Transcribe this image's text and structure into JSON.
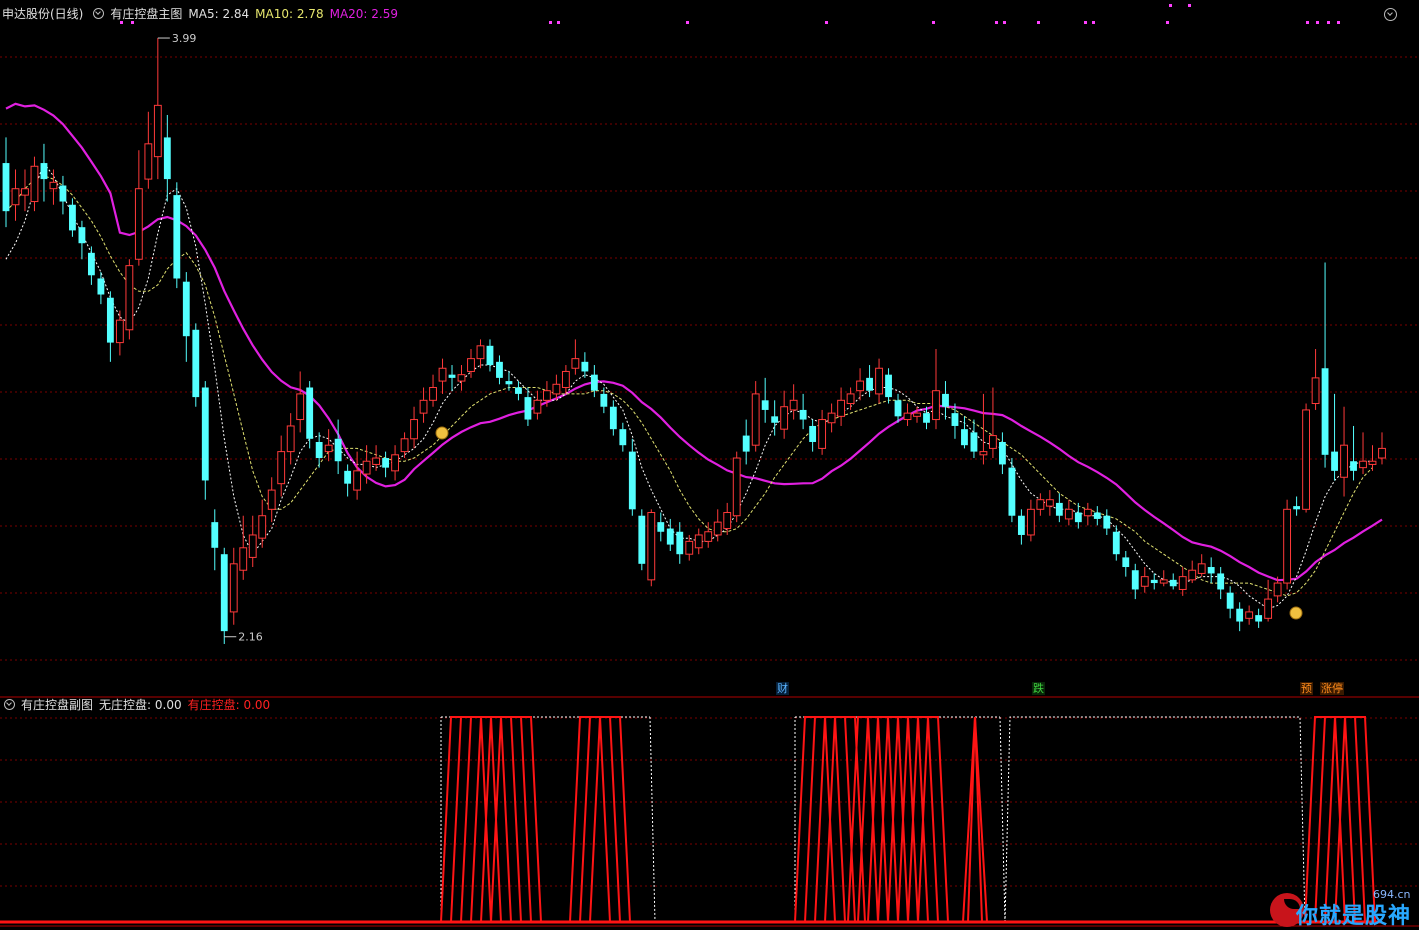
{
  "main_header": {
    "stock_name": "申达股份(日线)",
    "indicator_name": "有庄控盘主图",
    "ma5": "MA5: 2.84",
    "ma10": "MA10: 2.78",
    "ma20": "MA20: 2.59"
  },
  "sub_header": {
    "indicator_name": "有庄控盘副图",
    "no_control": "无庄控盘: 0.00",
    "with_control": "有庄控盘: 0.00"
  },
  "annotations": {
    "high_label": "3.99",
    "low_label": "2.16"
  },
  "events": [
    {
      "label": "财",
      "color": "#5ab4ff",
      "bg": "#06203a"
    },
    {
      "label": "跌",
      "color": "#3fd13f",
      "bg": "#082808"
    },
    {
      "label": "预",
      "color": "#ff8c1a",
      "bg": "#3a1a00"
    },
    {
      "label": "涨停",
      "color": "#ff8c1a",
      "bg": "#3a1a00"
    }
  ],
  "colors": {
    "up": "#ff3a3a",
    "down": "#54ffff",
    "ma20": "#e020e0",
    "ma_dash": "#e0e070",
    "grid": "#7a0000",
    "sub_red": "#ff1414",
    "sub_white": "#ffffff",
    "marker": "#ff40ff"
  },
  "watermark": {
    "text": "你就是股神",
    "site": "694.cn"
  },
  "chart_data": {
    "type": "candlestick",
    "ylim": [
      2.05,
      4.04
    ],
    "high": 3.99,
    "low": 2.16,
    "candles": [
      [
        3.6,
        3.45,
        3.68,
        3.4
      ],
      [
        3.47,
        3.52,
        3.58,
        3.42
      ],
      [
        3.5,
        3.52,
        3.58,
        3.45
      ],
      [
        3.48,
        3.59,
        3.62,
        3.45
      ],
      [
        3.6,
        3.55,
        3.66,
        3.48
      ],
      [
        3.52,
        3.54,
        3.58,
        3.47
      ],
      [
        3.53,
        3.48,
        3.56,
        3.44
      ],
      [
        3.47,
        3.39,
        3.49,
        3.37
      ],
      [
        3.4,
        3.35,
        3.42,
        3.3
      ],
      [
        3.32,
        3.25,
        3.34,
        3.22
      ],
      [
        3.24,
        3.19,
        3.26,
        3.16
      ],
      [
        3.18,
        3.04,
        3.2,
        2.98
      ],
      [
        3.04,
        3.11,
        3.14,
        3.0
      ],
      [
        3.08,
        3.28,
        3.3,
        3.05
      ],
      [
        3.3,
        3.52,
        3.64,
        3.28
      ],
      [
        3.55,
        3.66,
        3.76,
        3.52
      ],
      [
        3.62,
        3.78,
        3.99,
        3.55
      ],
      [
        3.68,
        3.55,
        3.75,
        3.48
      ],
      [
        3.5,
        3.24,
        3.54,
        3.21
      ],
      [
        3.23,
        3.06,
        3.26,
        2.98
      ],
      [
        3.08,
        2.87,
        3.1,
        2.84
      ],
      [
        2.9,
        2.61,
        2.92,
        2.55
      ],
      [
        2.48,
        2.4,
        2.52,
        2.33
      ],
      [
        2.38,
        2.14,
        2.4,
        2.1
      ],
      [
        2.2,
        2.35,
        2.4,
        2.16
      ],
      [
        2.33,
        2.4,
        2.5,
        2.3
      ],
      [
        2.37,
        2.44,
        2.5,
        2.34
      ],
      [
        2.43,
        2.5,
        2.55,
        2.4
      ],
      [
        2.52,
        2.58,
        2.62,
        2.48
      ],
      [
        2.6,
        2.7,
        2.75,
        2.56
      ],
      [
        2.7,
        2.78,
        2.82,
        2.66
      ],
      [
        2.8,
        2.88,
        2.95,
        2.76
      ],
      [
        2.9,
        2.74,
        2.92,
        2.71
      ],
      [
        2.73,
        2.68,
        2.76,
        2.65
      ],
      [
        2.7,
        2.72,
        2.77,
        2.67
      ],
      [
        2.74,
        2.67,
        2.8,
        2.63
      ],
      [
        2.64,
        2.6,
        2.66,
        2.56
      ],
      [
        2.58,
        2.64,
        2.7,
        2.55
      ],
      [
        2.63,
        2.67,
        2.72,
        2.6
      ],
      [
        2.66,
        2.68,
        2.72,
        2.64
      ],
      [
        2.68,
        2.65,
        2.7,
        2.62
      ],
      [
        2.64,
        2.69,
        2.72,
        2.61
      ],
      [
        2.7,
        2.74,
        2.76,
        2.68
      ],
      [
        2.74,
        2.8,
        2.84,
        2.71
      ],
      [
        2.82,
        2.86,
        2.9,
        2.79
      ],
      [
        2.86,
        2.9,
        2.94,
        2.84
      ],
      [
        2.92,
        2.96,
        2.99,
        2.88
      ],
      [
        2.94,
        2.93,
        2.97,
        2.89
      ],
      [
        2.92,
        2.94,
        2.97,
        2.89
      ],
      [
        2.95,
        2.99,
        3.02,
        2.93
      ],
      [
        2.99,
        3.03,
        3.05,
        2.96
      ],
      [
        3.03,
        2.97,
        3.05,
        2.95
      ],
      [
        2.98,
        2.93,
        3.0,
        2.91
      ],
      [
        2.92,
        2.91,
        2.95,
        2.89
      ],
      [
        2.9,
        2.88,
        2.92,
        2.86
      ],
      [
        2.87,
        2.8,
        2.9,
        2.78
      ],
      [
        2.82,
        2.86,
        2.89,
        2.8
      ],
      [
        2.86,
        2.89,
        2.92,
        2.84
      ],
      [
        2.88,
        2.91,
        2.94,
        2.86
      ],
      [
        2.9,
        2.95,
        2.97,
        2.88
      ],
      [
        2.96,
        2.99,
        3.05,
        2.94
      ],
      [
        2.98,
        2.95,
        3.01,
        2.93
      ],
      [
        2.94,
        2.89,
        2.97,
        2.87
      ],
      [
        2.88,
        2.84,
        2.9,
        2.82
      ],
      [
        2.84,
        2.77,
        2.86,
        2.75
      ],
      [
        2.77,
        2.72,
        2.79,
        2.7
      ],
      [
        2.7,
        2.52,
        2.74,
        2.5
      ],
      [
        2.5,
        2.35,
        2.52,
        2.33
      ],
      [
        2.3,
        2.51,
        2.52,
        2.28
      ],
      [
        2.48,
        2.45,
        2.51,
        2.42
      ],
      [
        2.46,
        2.41,
        2.49,
        2.39
      ],
      [
        2.45,
        2.38,
        2.48,
        2.35
      ],
      [
        2.38,
        2.42,
        2.44,
        2.36
      ],
      [
        2.4,
        2.44,
        2.46,
        2.38
      ],
      [
        2.42,
        2.45,
        2.48,
        2.4
      ],
      [
        2.44,
        2.48,
        2.52,
        2.42
      ],
      [
        2.46,
        2.51,
        2.54,
        2.44
      ],
      [
        2.5,
        2.68,
        2.7,
        2.48
      ],
      [
        2.75,
        2.7,
        2.8,
        2.66
      ],
      [
        2.72,
        2.88,
        2.92,
        2.7
      ],
      [
        2.86,
        2.83,
        2.93,
        2.79
      ],
      [
        2.81,
        2.79,
        2.86,
        2.75
      ],
      [
        2.77,
        2.84,
        2.89,
        2.74
      ],
      [
        2.83,
        2.86,
        2.91,
        2.8
      ],
      [
        2.83,
        2.8,
        2.88,
        2.77
      ],
      [
        2.78,
        2.73,
        2.8,
        2.7
      ],
      [
        2.71,
        2.8,
        2.83,
        2.69
      ],
      [
        2.79,
        2.82,
        2.85,
        2.76
      ],
      [
        2.81,
        2.86,
        2.9,
        2.78
      ],
      [
        2.85,
        2.88,
        2.9,
        2.83
      ],
      [
        2.89,
        2.92,
        2.96,
        2.86
      ],
      [
        2.93,
        2.89,
        2.97,
        2.87
      ],
      [
        2.88,
        2.96,
        2.99,
        2.85
      ],
      [
        2.94,
        2.87,
        2.96,
        2.85
      ],
      [
        2.86,
        2.81,
        2.88,
        2.79
      ],
      [
        2.8,
        2.82,
        2.85,
        2.78
      ],
      [
        2.81,
        2.82,
        2.84,
        2.79
      ],
      [
        2.82,
        2.79,
        2.84,
        2.77
      ],
      [
        2.8,
        2.89,
        3.02,
        2.77
      ],
      [
        2.88,
        2.84,
        2.92,
        2.8
      ],
      [
        2.82,
        2.78,
        2.85,
        2.74
      ],
      [
        2.77,
        2.72,
        2.81,
        2.71
      ],
      [
        2.76,
        2.7,
        2.8,
        2.68
      ],
      [
        2.69,
        2.7,
        2.88,
        2.66
      ],
      [
        2.71,
        2.75,
        2.9,
        2.68
      ],
      [
        2.73,
        2.66,
        2.76,
        2.63
      ],
      [
        2.65,
        2.5,
        2.68,
        2.48
      ],
      [
        2.5,
        2.44,
        2.52,
        2.41
      ],
      [
        2.44,
        2.52,
        2.55,
        2.42
      ],
      [
        2.52,
        2.55,
        2.57,
        2.5
      ],
      [
        2.53,
        2.55,
        2.58,
        2.5
      ],
      [
        2.54,
        2.5,
        2.57,
        2.48
      ],
      [
        2.49,
        2.52,
        2.55,
        2.47
      ],
      [
        2.51,
        2.48,
        2.54,
        2.46
      ],
      [
        2.5,
        2.52,
        2.54,
        2.47
      ],
      [
        2.51,
        2.49,
        2.53,
        2.47
      ],
      [
        2.5,
        2.46,
        2.52,
        2.44
      ],
      [
        2.45,
        2.38,
        2.47,
        2.36
      ],
      [
        2.37,
        2.34,
        2.39,
        2.31
      ],
      [
        2.33,
        2.27,
        2.35,
        2.24
      ],
      [
        2.28,
        2.31,
        2.34,
        2.26
      ],
      [
        2.3,
        2.29,
        2.32,
        2.27
      ],
      [
        2.29,
        2.3,
        2.33,
        2.28
      ],
      [
        2.3,
        2.28,
        2.32,
        2.27
      ],
      [
        2.27,
        2.31,
        2.34,
        2.25
      ],
      [
        2.3,
        2.33,
        2.36,
        2.29
      ],
      [
        2.32,
        2.35,
        2.38,
        2.31
      ],
      [
        2.34,
        2.32,
        2.37,
        2.29
      ],
      [
        2.32,
        2.27,
        2.34,
        2.24
      ],
      [
        2.26,
        2.21,
        2.28,
        2.18
      ],
      [
        2.21,
        2.17,
        2.23,
        2.14
      ],
      [
        2.18,
        2.2,
        2.22,
        2.16
      ],
      [
        2.19,
        2.17,
        2.21,
        2.15
      ],
      [
        2.18,
        2.24,
        2.3,
        2.17
      ],
      [
        2.25,
        2.29,
        2.31,
        2.23
      ],
      [
        2.29,
        2.52,
        2.55,
        2.27
      ],
      [
        2.53,
        2.52,
        2.56,
        2.5
      ],
      [
        2.52,
        2.83,
        2.85,
        2.51
      ],
      [
        2.85,
        2.93,
        3.02,
        2.83
      ],
      [
        2.96,
        2.69,
        3.29,
        2.65
      ],
      [
        2.7,
        2.64,
        2.88,
        2.61
      ],
      [
        2.62,
        2.72,
        2.84,
        2.56
      ],
      [
        2.67,
        2.64,
        2.78,
        2.61
      ],
      [
        2.65,
        2.67,
        2.76,
        2.63
      ],
      [
        2.66,
        2.67,
        2.72,
        2.64
      ],
      [
        2.68,
        2.71,
        2.76,
        2.66
      ]
    ],
    "ma5": [
      3.3,
      3.35,
      3.42,
      3.52,
      3.6,
      3.56,
      3.5,
      3.44,
      3.38,
      3.32,
      3.26,
      3.18,
      3.12,
      3.1,
      3.15,
      3.24,
      3.38,
      3.5,
      3.52,
      3.46,
      3.34,
      3.16,
      2.96,
      2.74,
      2.56,
      2.44,
      2.38,
      2.42,
      2.46,
      2.55,
      2.62,
      2.7,
      2.74,
      2.75,
      2.74,
      2.71,
      2.68,
      2.66,
      2.66,
      2.65,
      2.66,
      2.67,
      2.69,
      2.71,
      2.74,
      2.79,
      2.85,
      2.89,
      2.92,
      2.95,
      2.97,
      2.97,
      2.96,
      2.95,
      2.92,
      2.89,
      2.86,
      2.86,
      2.86,
      2.88,
      2.92,
      2.94,
      2.93,
      2.91,
      2.87,
      2.83,
      2.75,
      2.65,
      2.58,
      2.52,
      2.46,
      2.43,
      2.43,
      2.42,
      2.42,
      2.44,
      2.46,
      2.51,
      2.57,
      2.64,
      2.72,
      2.78,
      2.81,
      2.83,
      2.82,
      2.8,
      2.79,
      2.8,
      2.82,
      2.84,
      2.87,
      2.89,
      2.9,
      2.9,
      2.89,
      2.87,
      2.84,
      2.82,
      2.83,
      2.81,
      2.8,
      2.79,
      2.76,
      2.73,
      2.72,
      2.71,
      2.66,
      2.61,
      2.57,
      2.55,
      2.53,
      2.52,
      2.52,
      2.51,
      2.5,
      2.5,
      2.49,
      2.46,
      2.43,
      2.39,
      2.35,
      2.32,
      2.3,
      2.29,
      2.29,
      2.3,
      2.31,
      2.31,
      2.31,
      2.3,
      2.28,
      2.25,
      2.23,
      2.21,
      2.22,
      2.25,
      2.31,
      2.39,
      2.48,
      2.56,
      2.61,
      2.64,
      2.66,
      2.67,
      2.67
    ],
    "ma10": [
      3.45,
      3.48,
      3.52,
      3.55,
      3.56,
      3.55,
      3.53,
      3.5,
      3.46,
      3.42,
      3.37,
      3.31,
      3.26,
      3.22,
      3.2,
      3.2,
      3.22,
      3.27,
      3.3,
      3.32,
      3.28,
      3.22,
      3.12,
      3.0,
      2.88,
      2.76,
      2.64,
      2.56,
      2.52,
      2.52,
      2.54,
      2.58,
      2.62,
      2.66,
      2.7,
      2.71,
      2.71,
      2.71,
      2.7,
      2.69,
      2.68,
      2.67,
      2.67,
      2.68,
      2.7,
      2.72,
      2.75,
      2.78,
      2.81,
      2.84,
      2.86,
      2.88,
      2.89,
      2.9,
      2.9,
      2.9,
      2.9,
      2.89,
      2.88,
      2.88,
      2.88,
      2.88,
      2.89,
      2.89,
      2.88,
      2.86,
      2.83,
      2.79,
      2.74,
      2.69,
      2.64,
      2.58,
      2.53,
      2.49,
      2.46,
      2.45,
      2.45,
      2.46,
      2.49,
      2.53,
      2.57,
      2.62,
      2.66,
      2.7,
      2.74,
      2.77,
      2.79,
      2.8,
      2.81,
      2.82,
      2.83,
      2.84,
      2.85,
      2.86,
      2.86,
      2.86,
      2.85,
      2.85,
      2.85,
      2.84,
      2.83,
      2.81,
      2.79,
      2.77,
      2.75,
      2.73,
      2.71,
      2.69,
      2.66,
      2.63,
      2.6,
      2.57,
      2.55,
      2.53,
      2.52,
      2.51,
      2.5,
      2.49,
      2.47,
      2.45,
      2.42,
      2.4,
      2.38,
      2.36,
      2.34,
      2.32,
      2.3,
      2.29,
      2.29,
      2.29,
      2.29,
      2.29,
      2.28,
      2.27,
      2.26,
      2.25,
      2.26,
      2.29,
      2.33,
      2.39,
      2.45,
      2.51,
      2.57,
      2.62,
      2.65
    ]
  }
}
